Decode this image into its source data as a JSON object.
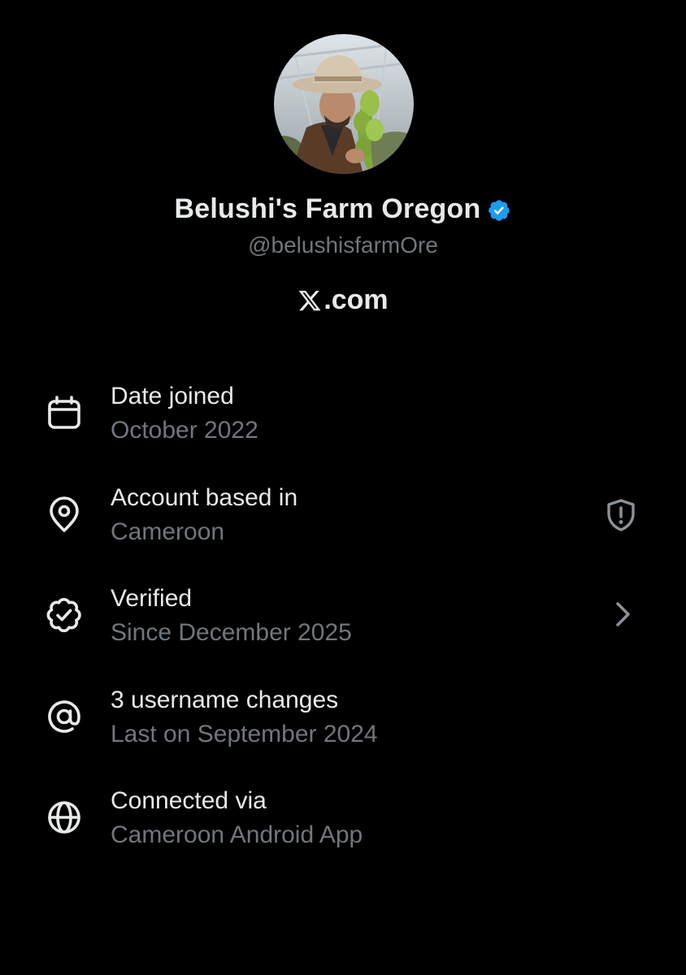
{
  "profile": {
    "display_name": "Belushi's Farm Oregon",
    "handle": "@belushisfarmOre",
    "brand_text": ".com",
    "verified_color": "#1d9bf0"
  },
  "info_rows": [
    {
      "icon": "calendar-icon",
      "title": "Date joined",
      "subtitle": "October 2022"
    },
    {
      "icon": "location-pin-icon",
      "title": "Account based in",
      "subtitle": "Cameroon",
      "action_icon": "shield-warning-icon"
    },
    {
      "icon": "verified-badge-outline-icon",
      "title": "Verified",
      "subtitle": "Since December 2025",
      "action_icon": "chevron-right-icon"
    },
    {
      "icon": "at-sign-icon",
      "title": "3 username changes",
      "subtitle": "Last on September 2024"
    },
    {
      "icon": "globe-icon",
      "title": "Connected via",
      "subtitle": "Cameroon Android App"
    }
  ],
  "colors": {
    "background": "#000000",
    "primary_text": "#e7e9ea",
    "secondary_text": "#71767b"
  }
}
